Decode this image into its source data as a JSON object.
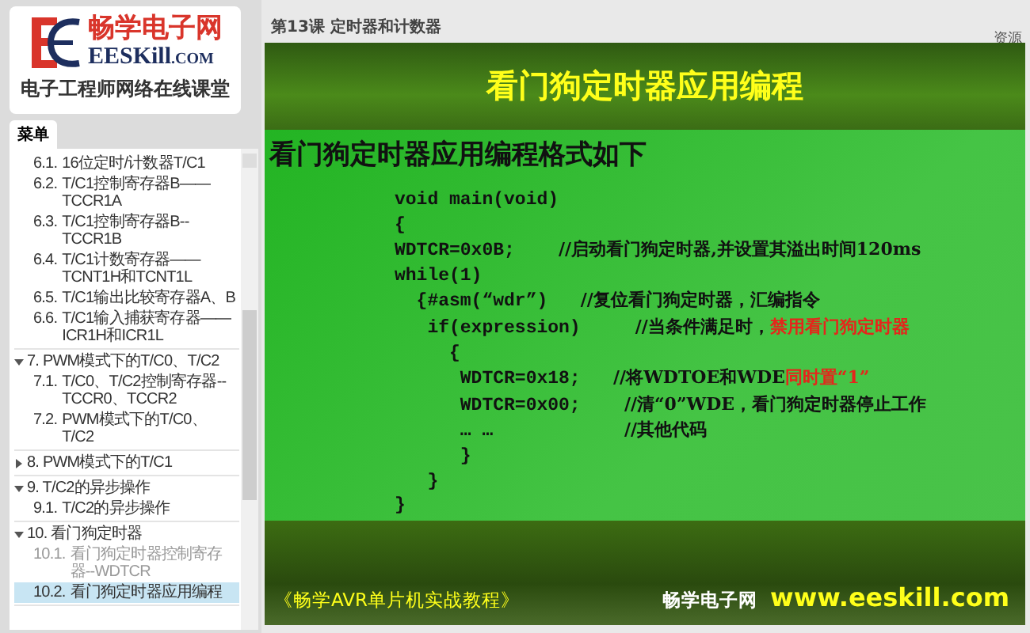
{
  "logo": {
    "brand": "畅学电子网",
    "domain": "EESKill",
    "domain_suffix": ".COM",
    "slogan": "电子工程师网络在线课堂"
  },
  "sidebar": {
    "tab": {
      "label": "菜单",
      "selected": true
    },
    "tree": [
      {
        "children": [
          {
            "number": "6.1.",
            "label": "16位定时/计数器T/C1",
            "selected": false,
            "dimmed": false
          },
          {
            "number": "6.2.",
            "label": "T/C1控制寄存器B——TCCR1A",
            "selected": false,
            "dimmed": false
          },
          {
            "number": "6.3.",
            "label": "T/C1控制寄存器B--TCCR1B",
            "selected": false,
            "dimmed": false
          },
          {
            "number": "6.4.",
            "label": "T/C1计数寄存器——TCNT1H和TCNT1L",
            "selected": false,
            "dimmed": false
          },
          {
            "number": "6.5.",
            "label": "T/C1输出比较寄存器A、B",
            "selected": false,
            "dimmed": false
          },
          {
            "number": "6.6.",
            "label": "T/C1输入捕获寄存器——ICR1H和ICR1L",
            "selected": false,
            "dimmed": false
          }
        ]
      },
      {
        "number": "7.",
        "label": "PWM模式下的T/C0、T/C2",
        "expanded": true,
        "children": [
          {
            "number": "7.1.",
            "label": "T/C0、T/C2控制寄存器--TCCR0、TCCR2",
            "selected": false,
            "dimmed": false
          },
          {
            "number": "7.2.",
            "label": "PWM模式下的T/C0、T/C2",
            "selected": false,
            "dimmed": false
          }
        ]
      },
      {
        "number": "8.",
        "label": "PWM模式下的T/C1",
        "expanded": false
      },
      {
        "number": "9.",
        "label": "T/C2的异步操作",
        "expanded": true,
        "children": [
          {
            "number": "9.1.",
            "label": "T/C2的异步操作",
            "selected": false,
            "dimmed": false
          }
        ]
      },
      {
        "number": "10.",
        "label": "看门狗定时器",
        "expanded": true,
        "children": [
          {
            "number": "10.1.",
            "label": "看门狗定时器控制寄存器--WDTCR",
            "selected": false,
            "dimmed": true
          },
          {
            "number": "10.2.",
            "label": "看门狗定时器应用编程",
            "selected": true,
            "dimmed": false
          }
        ]
      }
    ]
  },
  "header": {
    "lesson": "第13课 定时器和计数器",
    "resources_link": "资源"
  },
  "slide": {
    "title": "看门狗定时器应用编程",
    "subtitle": "看门狗定时器应用编程格式如下",
    "code_lines": [
      {
        "code": "void main(void)"
      },
      {
        "code": "{"
      },
      {
        "code": "WDTCR=0x0B;    ",
        "comment": "//启动看门狗定时器,并设置其溢出时间120ms"
      },
      {
        "code": "while(1)"
      },
      {
        "code": "  {#asm(“wdr”)   ",
        "comment": "//复位看门狗定时器，汇编指令"
      },
      {
        "code": "   if(expression)     ",
        "comment": "//当条件满足时，",
        "emphasis": "禁用看门狗定时器"
      },
      {
        "code": "     {"
      },
      {
        "code": "      WDTCR=0x18;   ",
        "comment": "//将WDTOE和WDE",
        "emphasis": "同时置“1”"
      },
      {
        "code": "      WDTCR=0x00;    ",
        "comment": "//清“0”WDE，看门狗定时器停止工作"
      },
      {
        "code": "      … …            ",
        "comment": "//其他代码"
      },
      {
        "code": "      }"
      },
      {
        "code": "   }"
      },
      {
        "code": "}"
      }
    ],
    "footer_title": "《畅学AVR单片机实战教程》",
    "footer_brand": "畅学电子网",
    "footer_url": "www.eeskill.com"
  }
}
